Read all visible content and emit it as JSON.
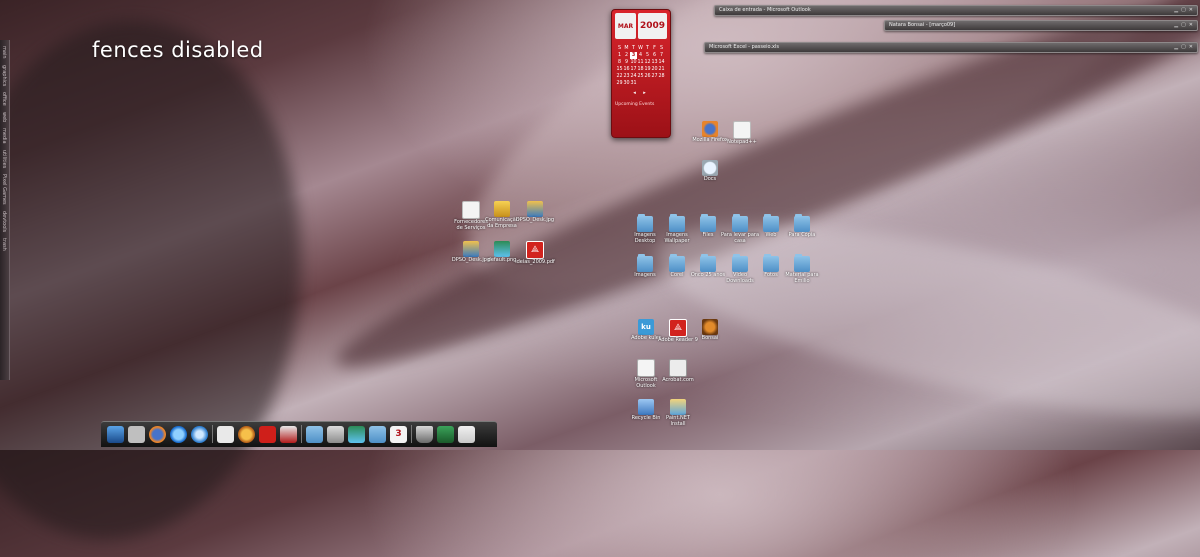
{
  "desktop": {
    "overlay_title": "fences disabled",
    "left_bar_items": [
      "main",
      "graphics",
      "office",
      "web",
      "media",
      "utilities",
      "Pixel Games",
      "devtools",
      "trash"
    ]
  },
  "calendar": {
    "month": "MAR",
    "year": "2009",
    "weekdays": [
      "S",
      "M",
      "T",
      "W",
      "T",
      "F",
      "S"
    ],
    "days": [
      "",
      "",
      "",
      "",
      "",
      "",
      "",
      "1",
      "2",
      "3",
      "4",
      "5",
      "6",
      "7",
      "8",
      "9",
      "10",
      "11",
      "12",
      "13",
      "14",
      "15",
      "16",
      "17",
      "18",
      "19",
      "20",
      "21",
      "22",
      "23",
      "24",
      "25",
      "26",
      "27",
      "28",
      "29",
      "30",
      "31",
      "",
      "",
      "",
      ""
    ],
    "today": "3",
    "events_label": "Upcoming Events"
  },
  "windows": [
    {
      "title": "Caixa de entrada - Microsoft Outlook"
    },
    {
      "title": "Natara Bonsai - [março09]"
    },
    {
      "title": "Microsoft Excel - passeio.xls"
    }
  ],
  "icons": {
    "top_group": [
      {
        "label": "Mozilla Firefox",
        "kind": "firefox"
      },
      {
        "label": "Notepad++",
        "kind": "doc"
      },
      {
        "label": "Docs",
        "kind": "search"
      }
    ],
    "middle_group": [
      {
        "label": "Fornecedores de Serviços",
        "kind": "doc"
      },
      {
        "label": "Comunicação da Empresa",
        "kind": "box"
      },
      {
        "label": "DPSO_Desk.jpg",
        "kind": "img1"
      },
      {
        "label": "DPSO_Desk.jpg",
        "kind": "img1"
      },
      {
        "label": "default.png",
        "kind": "img2"
      },
      {
        "label": "ideias_2009.pdf",
        "kind": "pdf"
      }
    ],
    "folders_row1": [
      {
        "label": "Imagens Desktop"
      },
      {
        "label": "Imagens Wallpaper"
      },
      {
        "label": "Files"
      },
      {
        "label": "Para levar para casa"
      },
      {
        "label": "Web"
      },
      {
        "label": "Para Cópia"
      }
    ],
    "folders_row2": [
      {
        "label": "Imagens"
      },
      {
        "label": "Corel"
      },
      {
        "label": "Onco 25 anos"
      },
      {
        "label": "Vídeo Downloads"
      },
      {
        "label": "Fotos"
      },
      {
        "label": "Material para Emilio"
      }
    ],
    "apps_row1": [
      {
        "label": "Adobe kuler",
        "kind": "kuler",
        "glyph": "ku"
      },
      {
        "label": "Adobe Reader 9",
        "kind": "pdf"
      },
      {
        "label": "Bonsai",
        "kind": "bonsai"
      }
    ],
    "apps_row2": [
      {
        "label": "Microsoft Outlook",
        "kind": "mail"
      },
      {
        "label": "Acrobat.com",
        "kind": "acro"
      }
    ],
    "apps_row3": [
      {
        "label": "Recycle Bin",
        "kind": "bin"
      },
      {
        "label": "Paint.NET Install",
        "kind": "paint"
      }
    ]
  }
}
